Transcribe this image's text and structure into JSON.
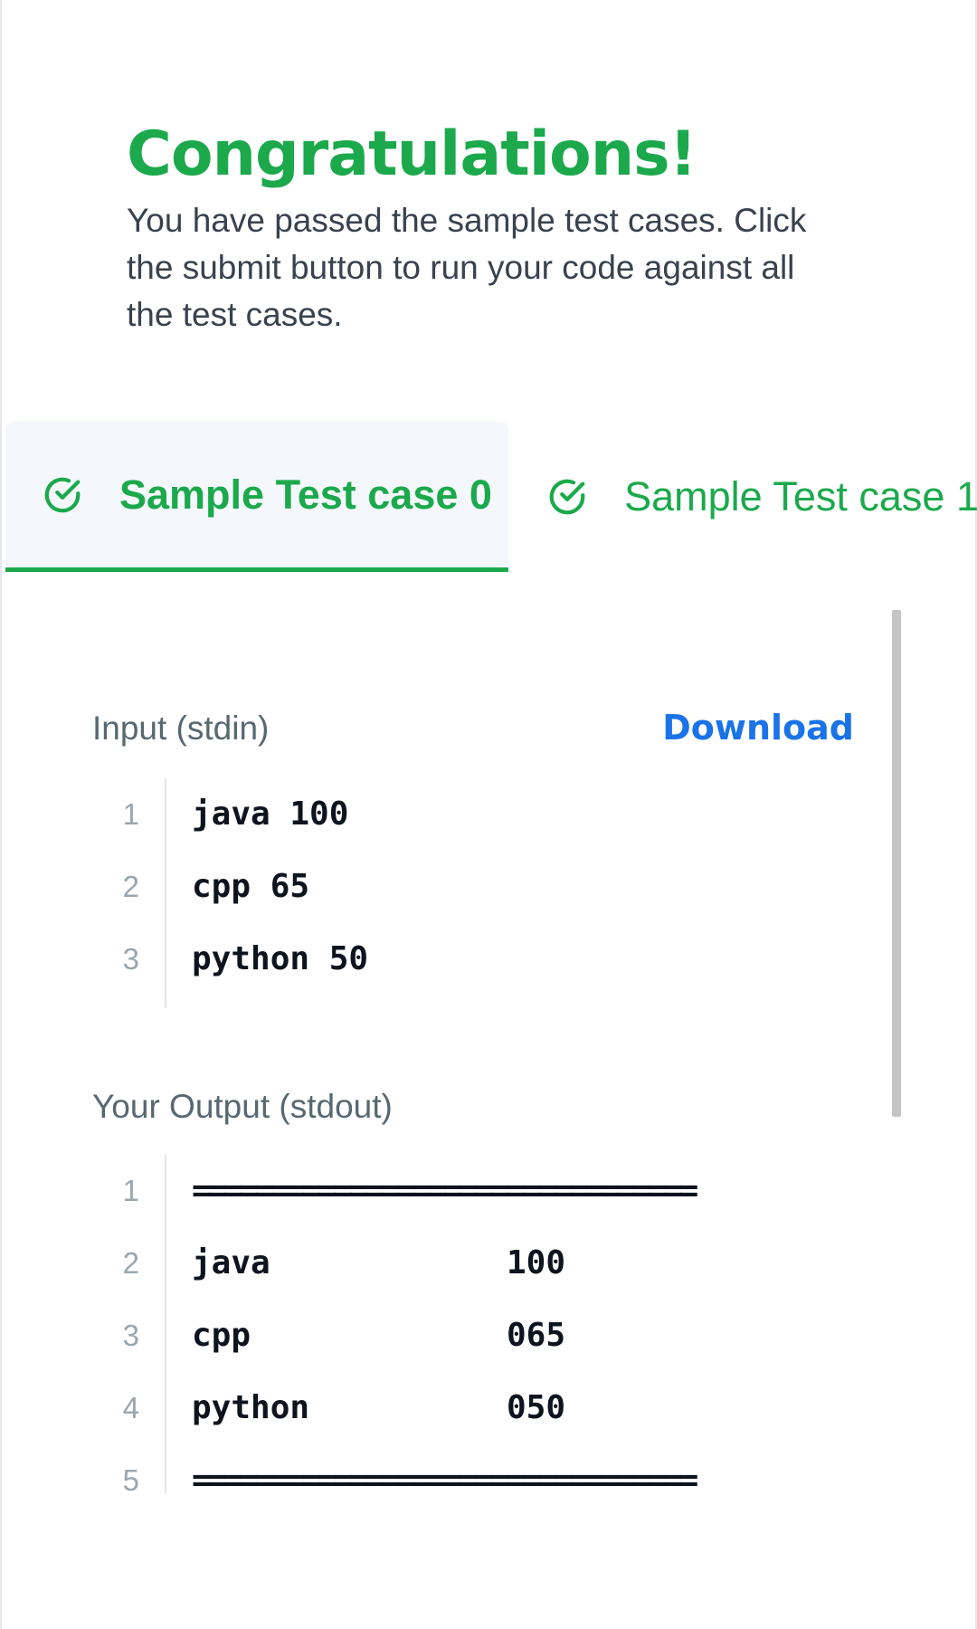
{
  "header": {
    "title": "Congratulations!",
    "description": "You have passed the sample test cases. Click the submit button to run your code against all the test cases."
  },
  "tabs": [
    {
      "label": "Sample Test case 0",
      "icon": "check-circle-icon",
      "active": true
    },
    {
      "label": "Sample Test case 1",
      "icon": "check-circle-icon",
      "active": false
    }
  ],
  "input": {
    "label": "Input (stdin)",
    "download_label": "Download",
    "lines": [
      {
        "num": "1",
        "text": "java 100"
      },
      {
        "num": "2",
        "text": "cpp 65"
      },
      {
        "num": "3",
        "text": "python 50"
      }
    ]
  },
  "output": {
    "label": "Your Output (stdout)",
    "lines": [
      {
        "num": "1",
        "text": "================================",
        "value": ""
      },
      {
        "num": "2",
        "text": "java",
        "value": "100"
      },
      {
        "num": "3",
        "text": "cpp",
        "value": "065"
      },
      {
        "num": "4",
        "text": "python",
        "value": "050"
      },
      {
        "num": "5",
        "text": "================================",
        "value": ""
      }
    ]
  },
  "colors": {
    "success": "#1ba94c",
    "link": "#1a73e8",
    "text": "#39424e"
  }
}
